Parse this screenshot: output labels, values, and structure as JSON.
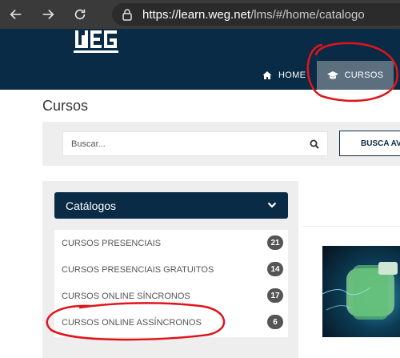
{
  "browser": {
    "url_host": "https://learn.weg.net",
    "url_path": "/lms/#/home/catalogo"
  },
  "header": {
    "logo_text": "WEG",
    "nav": {
      "home_label": "HOME",
      "cursos_label": "CURSOS"
    }
  },
  "page": {
    "title": "Cursos"
  },
  "search": {
    "placeholder": "Buscar...",
    "button_label": "BUSCA AVANÇADA"
  },
  "catalog": {
    "header": "Catálogos",
    "items": [
      {
        "label": "CURSOS PRESENCIAIS",
        "count": "21"
      },
      {
        "label": "CURSOS PRESENCIAIS GRATUITOS",
        "count": "14"
      },
      {
        "label": "CURSOS ONLINE SÍNCRONOS",
        "count": "17"
      },
      {
        "label": "CURSOS ONLINE ASSÍNCRONOS",
        "count": "6"
      }
    ]
  },
  "colors": {
    "brand_navy": "#0a2b45",
    "active_tab": "#5b6f7f",
    "annotation_red": "#e0141b"
  }
}
